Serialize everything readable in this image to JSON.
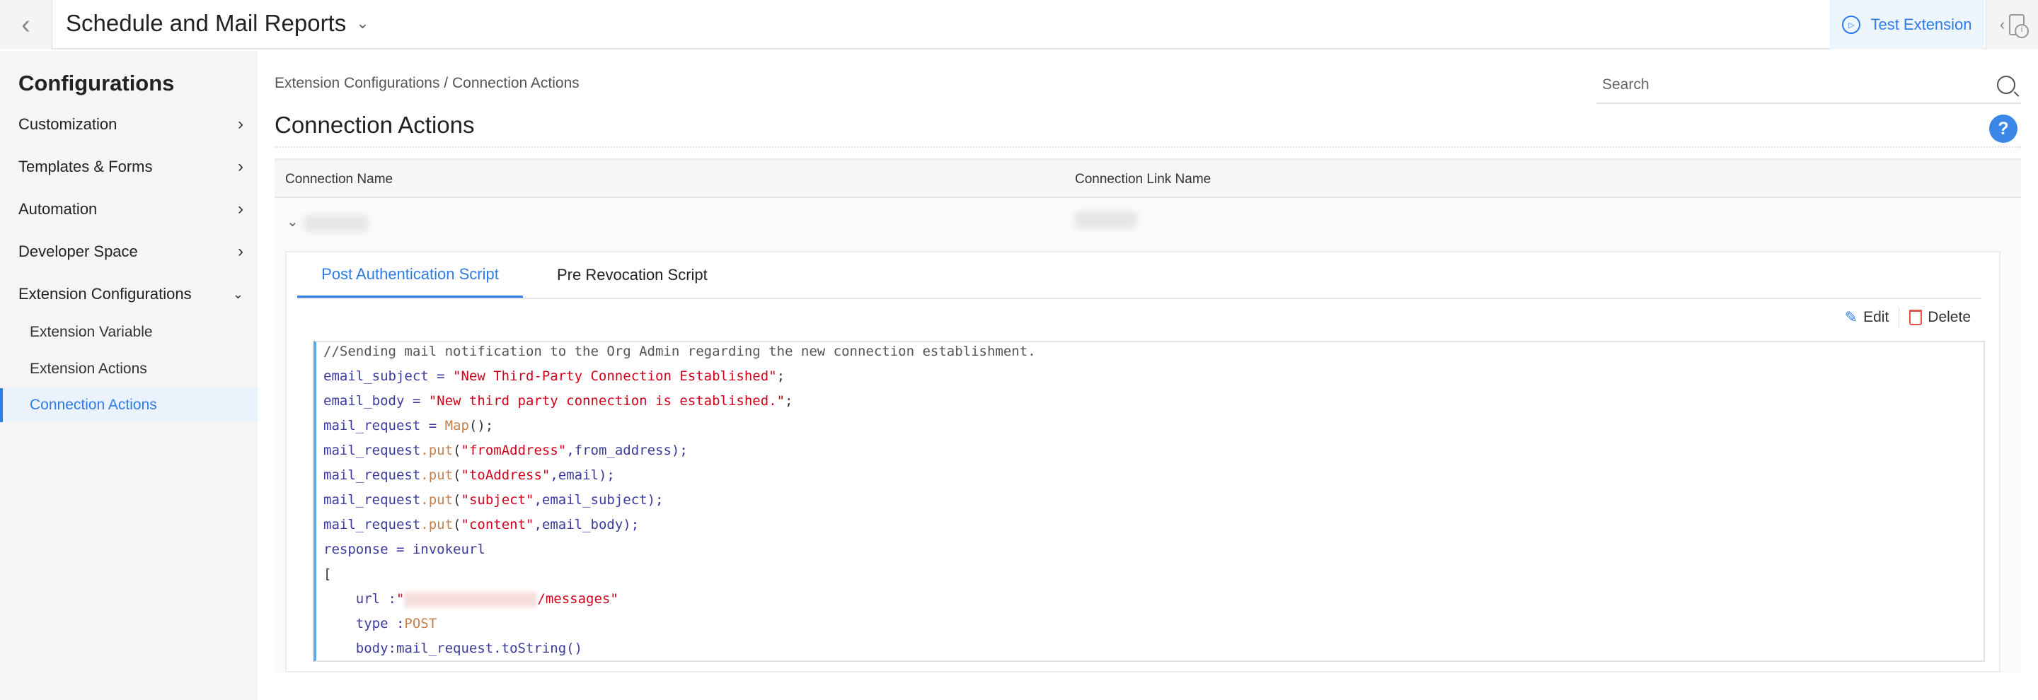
{
  "topbar": {
    "title": "Schedule and Mail Reports",
    "test_extension": "Test Extension"
  },
  "sidebar": {
    "heading": "Configurations",
    "items": [
      {
        "label": "Customization"
      },
      {
        "label": "Templates & Forms"
      },
      {
        "label": "Automation"
      },
      {
        "label": "Developer Space"
      },
      {
        "label": "Extension Configurations"
      }
    ],
    "subitems": [
      {
        "label": "Extension Variable"
      },
      {
        "label": "Extension Actions"
      },
      {
        "label": "Connection Actions",
        "active": true
      }
    ]
  },
  "main": {
    "breadcrumb": "Extension Configurations / Connection Actions",
    "title": "Connection Actions",
    "search_placeholder": "Search",
    "help": "?",
    "columns": [
      "Connection Name",
      "Connection Link Name"
    ],
    "tabs": [
      "Post Authentication Script",
      "Pre Revocation Script"
    ],
    "edit": "Edit",
    "delete": "Delete",
    "code": {
      "l1": "//Sending mail notification to the Org Admin regarding the new connection establishment.",
      "l2a": "email_subject = ",
      "l2b": "\"New Third-Party Connection Established\"",
      "l2c": ";",
      "l3a": "email_body = ",
      "l3b": "\"New third party connection is established.\"",
      "l3c": ";",
      "l4a": "mail_request = ",
      "l4b": "Map",
      "l4c": "();",
      "put": ".put",
      "mr": "mail_request",
      "op": "(",
      "l5s": "\"fromAddress\"",
      "l5v": ",from_address);",
      "l6s": "\"toAddress\"",
      "l6v": ",email);",
      "l7s": "\"subject\"",
      "l7v": ",email_subject);",
      "l8s": "\"content\"",
      "l8v": ",email_body);",
      "l9": "response = invokeurl",
      "l10": "[",
      "l11a": "    url :",
      "l11b": "\"",
      "l11c": "/messages\"",
      "l12a": "    type :",
      "l12b": "POST",
      "l13": "    body:mail_request.toString()"
    }
  }
}
